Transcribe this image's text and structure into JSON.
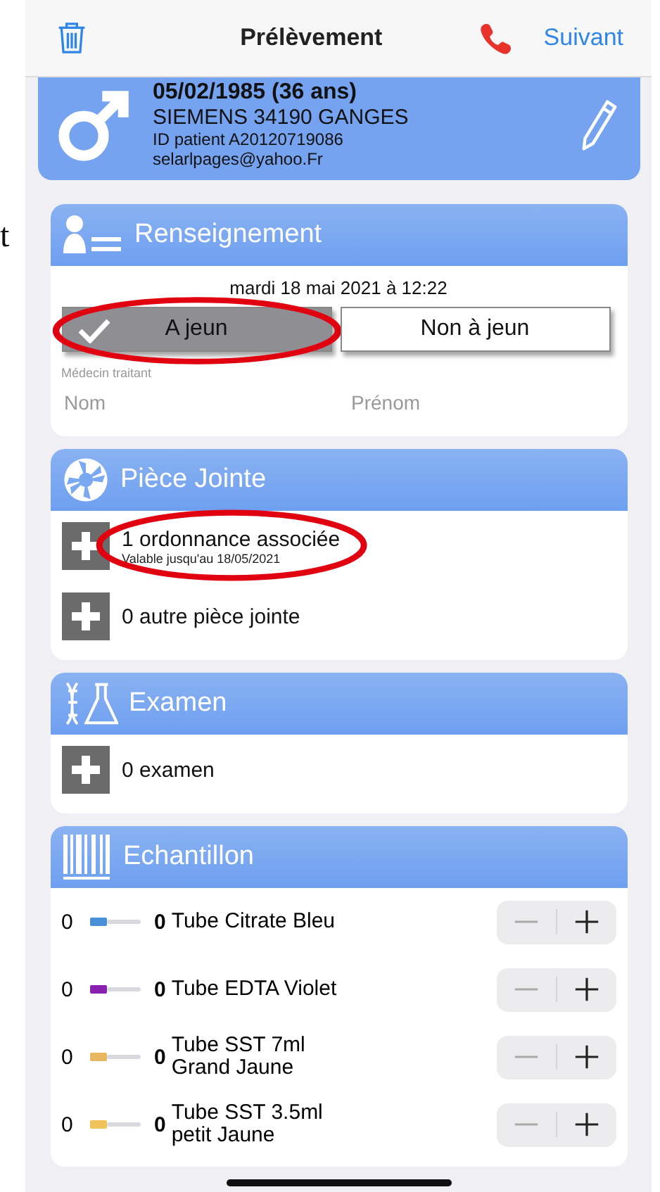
{
  "margin_text": "t",
  "nav": {
    "title": "Prélèvement",
    "next": "Suivant"
  },
  "patient": {
    "birth": "05/02/1985 (36 ans)",
    "address": "SIEMENS 34190 GANGES",
    "patient_id": "ID patient A20120719086",
    "email": "selarlpages@yahoo.Fr"
  },
  "renseignement": {
    "title": "Renseignement",
    "date": "mardi 18 mai 2021 à 12:22",
    "fasting": [
      {
        "label": "A jeun",
        "selected": true,
        "circled": true
      },
      {
        "label": "Non à jeun",
        "selected": false,
        "circled": false
      }
    ],
    "doctor_label": "Médecin traitant",
    "fields": [
      {
        "placeholder": "Nom"
      },
      {
        "placeholder": "Prénom"
      }
    ]
  },
  "piece_jointe": {
    "title": "Pièce Jointe",
    "items": [
      {
        "title": "1 ordonnance associée",
        "subtitle": "Valable jusqu'au 18/05/2021",
        "circled": true
      },
      {
        "title": "0 autre pièce jointe",
        "circled": false
      }
    ]
  },
  "examen": {
    "title": "Examen",
    "items": [
      {
        "title": "0 examen"
      }
    ]
  },
  "echantillon": {
    "title": "Echantillon",
    "samples": [
      {
        "count": "0",
        "color": "#4a90d9",
        "qty": "0",
        "name_lines": [
          "Tube Citrate Bleu"
        ]
      },
      {
        "count": "0",
        "color": "#8a1fb0",
        "qty": "0",
        "name_lines": [
          "Tube EDTA Violet"
        ]
      },
      {
        "count": "0",
        "color": "#e8b860",
        "qty": "0",
        "name_lines": [
          "Tube SST 7ml",
          "Grand Jaune"
        ]
      },
      {
        "count": "0",
        "color": "#f2c25a",
        "qty": "0",
        "name_lines": [
          "Tube SST 3.5ml",
          "petit Jaune"
        ]
      }
    ]
  }
}
